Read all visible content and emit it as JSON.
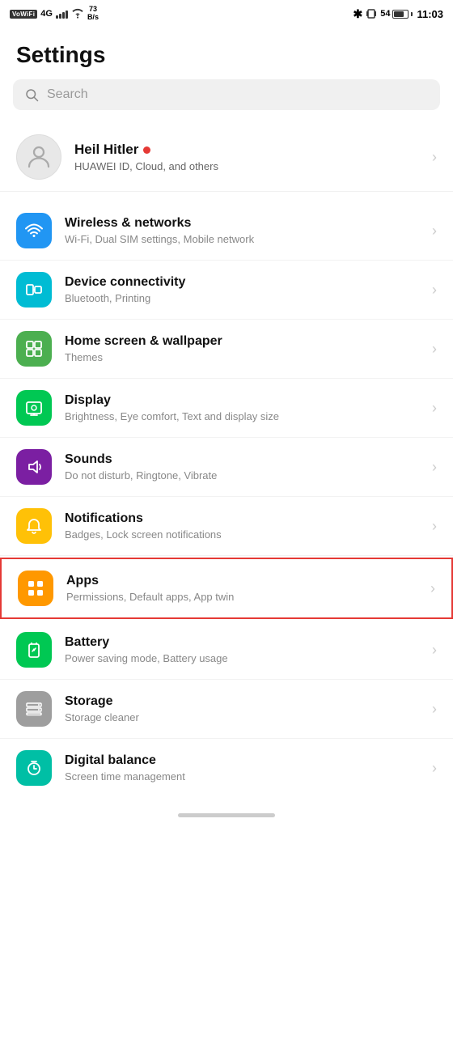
{
  "statusBar": {
    "left": {
      "vowifi": "VoWiFi",
      "signal": "4G",
      "speed": "73\nB/s"
    },
    "right": {
      "bluetooth": "✱",
      "battery_level": "54",
      "time": "11:03"
    }
  },
  "page": {
    "title": "Settings"
  },
  "search": {
    "placeholder": "Search"
  },
  "profile": {
    "name": "Heil Hitler",
    "subtitle": "HUAWEI ID, Cloud, and others"
  },
  "settings_items": [
    {
      "id": "wireless",
      "title": "Wireless & networks",
      "subtitle": "Wi-Fi, Dual SIM settings, Mobile network",
      "icon_color": "icon-blue",
      "icon": "wifi"
    },
    {
      "id": "device_connectivity",
      "title": "Device connectivity",
      "subtitle": "Bluetooth, Printing",
      "icon_color": "icon-teal",
      "icon": "devices"
    },
    {
      "id": "home_screen",
      "title": "Home screen & wallpaper",
      "subtitle": "Themes",
      "icon_color": "icon-green-dark",
      "icon": "home"
    },
    {
      "id": "display",
      "title": "Display",
      "subtitle": "Brightness, Eye comfort, Text and display size",
      "icon_color": "icon-green-bright",
      "icon": "display"
    },
    {
      "id": "sounds",
      "title": "Sounds",
      "subtitle": "Do not disturb, Ringtone, Vibrate",
      "icon_color": "icon-purple",
      "icon": "sound"
    },
    {
      "id": "notifications",
      "title": "Notifications",
      "subtitle": "Badges, Lock screen notifications",
      "icon_color": "icon-yellow",
      "icon": "notification"
    },
    {
      "id": "apps",
      "title": "Apps",
      "subtitle": "Permissions, Default apps, App twin",
      "icon_color": "icon-orange",
      "icon": "apps",
      "highlighted": true
    },
    {
      "id": "battery",
      "title": "Battery",
      "subtitle": "Power saving mode, Battery usage",
      "icon_color": "icon-green-bright",
      "icon": "battery"
    },
    {
      "id": "storage",
      "title": "Storage",
      "subtitle": "Storage cleaner",
      "icon_color": "icon-gray",
      "icon": "storage"
    },
    {
      "id": "digital_balance",
      "title": "Digital balance",
      "subtitle": "Screen time management",
      "icon_color": "icon-teal-green",
      "icon": "timer"
    }
  ]
}
